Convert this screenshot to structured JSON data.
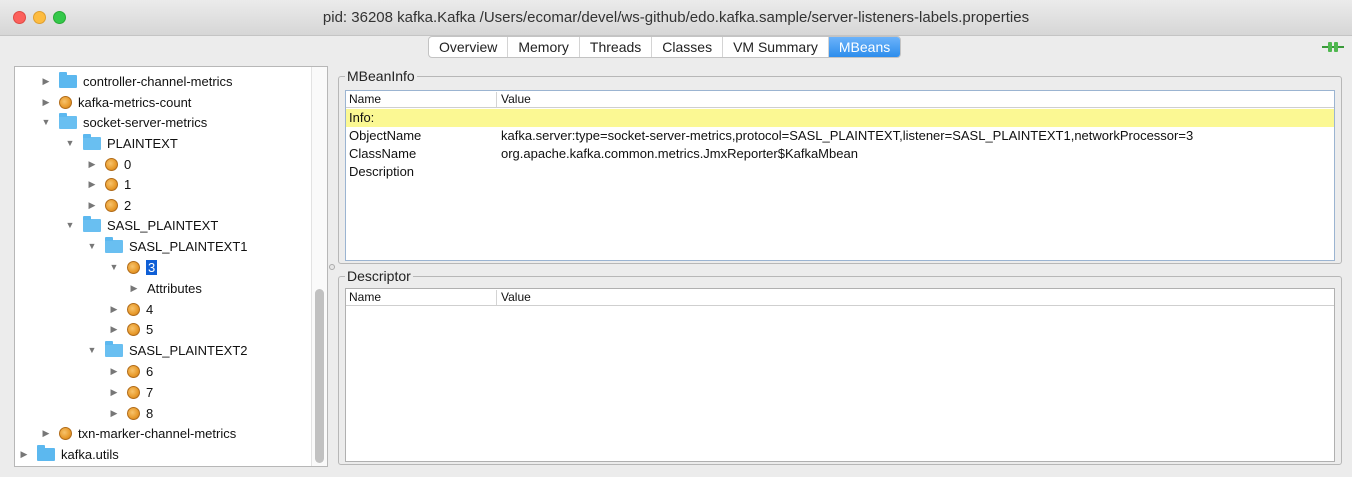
{
  "window": {
    "title": "pid: 36208 kafka.Kafka /Users/ecomar/devel/ws-github/edo.kafka.sample/server-listeners-labels.properties"
  },
  "tabs": [
    {
      "label": "Overview"
    },
    {
      "label": "Memory"
    },
    {
      "label": "Threads"
    },
    {
      "label": "Classes"
    },
    {
      "label": "VM Summary"
    },
    {
      "label": "MBeans"
    }
  ],
  "active_tab": "MBeans",
  "tree": {
    "items": [
      {
        "label": "controller-channel-metrics",
        "icon": "folder-icon",
        "expanded": false
      },
      {
        "label": "kafka-metrics-count",
        "icon": "bean-icon",
        "expanded": false
      },
      {
        "label": "socket-server-metrics",
        "icon": "folder-icon",
        "expanded": true
      },
      {
        "label": "PLAINTEXT",
        "icon": "folder-icon",
        "expanded": true
      },
      {
        "label": "0",
        "icon": "bean-icon",
        "expanded": false
      },
      {
        "label": "1",
        "icon": "bean-icon",
        "expanded": false
      },
      {
        "label": "2",
        "icon": "bean-icon",
        "expanded": false
      },
      {
        "label": "SASL_PLAINTEXT",
        "icon": "folder-icon",
        "expanded": true
      },
      {
        "label": "SASL_PLAINTEXT1",
        "icon": "folder-icon",
        "expanded": true
      },
      {
        "label": "3",
        "icon": "bean-icon",
        "expanded": true,
        "selected": true
      },
      {
        "label": "Attributes",
        "icon": "none",
        "expanded": false
      },
      {
        "label": "4",
        "icon": "bean-icon",
        "expanded": false
      },
      {
        "label": "5",
        "icon": "bean-icon",
        "expanded": false
      },
      {
        "label": "SASL_PLAINTEXT2",
        "icon": "folder-icon",
        "expanded": true
      },
      {
        "label": "6",
        "icon": "bean-icon",
        "expanded": false
      },
      {
        "label": "7",
        "icon": "bean-icon",
        "expanded": false
      },
      {
        "label": "8",
        "icon": "bean-icon",
        "expanded": false
      },
      {
        "label": "txn-marker-channel-metrics",
        "icon": "bean-icon",
        "expanded": false
      },
      {
        "label": "kafka.utils",
        "icon": "folder-icon",
        "expanded": false
      }
    ]
  },
  "mbeaninfo": {
    "title": "MBeanInfo",
    "col_name": "Name",
    "col_value": "Value",
    "rows": [
      {
        "name": "Info:",
        "value": ""
      },
      {
        "name": "ObjectName",
        "value": "kafka.server:type=socket-server-metrics,protocol=SASL_PLAINTEXT,listener=SASL_PLAINTEXT1,networkProcessor=3"
      },
      {
        "name": "ClassName",
        "value": "org.apache.kafka.common.metrics.JmxReporter$KafkaMbean"
      },
      {
        "name": "Description",
        "value": ""
      }
    ]
  },
  "descriptor": {
    "title": "Descriptor",
    "col_name": "Name",
    "col_value": "Value"
  },
  "colors": {
    "accent": "#2d8dec",
    "selection": "#0f5fd6",
    "info_row": "#fbf893",
    "folder": "#5cb8ef"
  }
}
